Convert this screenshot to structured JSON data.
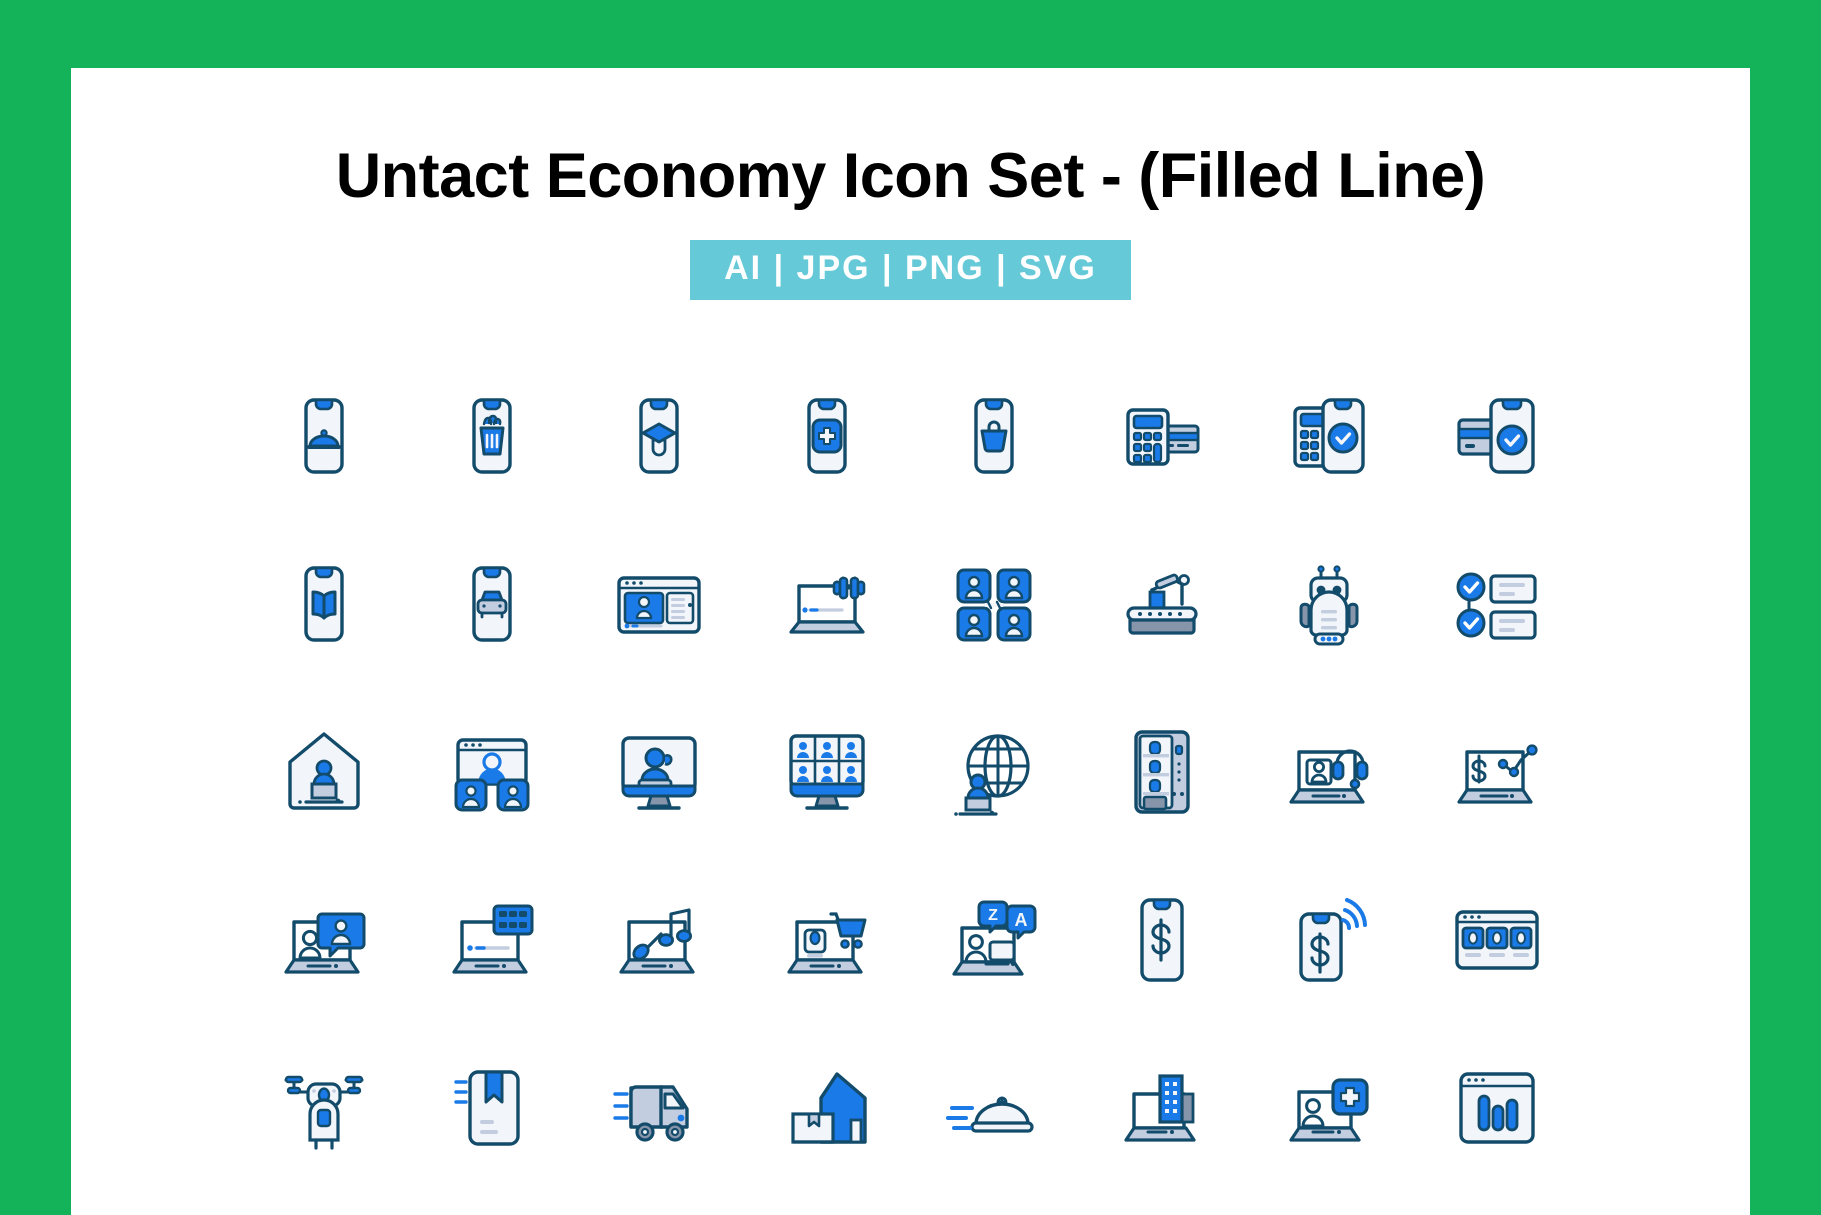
{
  "poster": {
    "frame_color": "#14b35a",
    "panel_color": "#ffffff",
    "title": "Untact Economy Icon Set - (Filled Line)",
    "badge": {
      "text": "AI | JPG | PNG | SVG",
      "background": "#66c9d8",
      "text_color": "#ffffff"
    }
  },
  "palette": {
    "outline": "#134b6b",
    "primary_blue": "#1a7ae8",
    "light_fill": "#f2f5fa",
    "grey_blue": "#c3cde0",
    "mid_grey": "#8795ab"
  },
  "grid": {
    "columns": 8,
    "rows": 5,
    "total_icons": 40
  },
  "icons": [
    {
      "id": "mobile-food-delivery",
      "label": "Mobile Food Delivery",
      "row": 1,
      "col": 1
    },
    {
      "id": "mobile-fast-food-order",
      "label": "Mobile Fast Food Order",
      "row": 1,
      "col": 2
    },
    {
      "id": "mobile-online-education",
      "label": "Mobile Online Education",
      "row": 1,
      "col": 3
    },
    {
      "id": "mobile-healthcare-app",
      "label": "Mobile Healthcare App",
      "row": 1,
      "col": 4
    },
    {
      "id": "mobile-shopping-basket",
      "label": "Mobile Shopping Basket",
      "row": 1,
      "col": 5
    },
    {
      "id": "card-reader-payment",
      "label": "Card Reader Payment",
      "row": 1,
      "col": 6
    },
    {
      "id": "pos-mobile-payment-approved",
      "label": "POS Mobile Payment Approved",
      "row": 1,
      "col": 7
    },
    {
      "id": "credit-card-mobile-verified",
      "label": "Credit Card Mobile Verified",
      "row": 1,
      "col": 8
    },
    {
      "id": "mobile-ebook-reading",
      "label": "Mobile E-Book Reading",
      "row": 2,
      "col": 1
    },
    {
      "id": "mobile-ride-hailing",
      "label": "Mobile Ride Hailing",
      "row": 2,
      "col": 2
    },
    {
      "id": "video-streaming-window",
      "label": "Video Streaming Window",
      "row": 2,
      "col": 3
    },
    {
      "id": "laptop-online-fitness",
      "label": "Laptop Online Fitness",
      "row": 2,
      "col": 4
    },
    {
      "id": "group-video-conference",
      "label": "Group Video Conference",
      "row": 2,
      "col": 5
    },
    {
      "id": "factory-automation-arm",
      "label": "Factory Automation Robot Arm",
      "row": 2,
      "col": 6
    },
    {
      "id": "service-robot",
      "label": "Service Robot",
      "row": 2,
      "col": 7
    },
    {
      "id": "online-checklist-approval",
      "label": "Online Checklist Approval",
      "row": 2,
      "col": 8
    },
    {
      "id": "work-from-home",
      "label": "Work From Home",
      "row": 3,
      "col": 1
    },
    {
      "id": "online-meeting-window",
      "label": "Online Meeting Window",
      "row": 3,
      "col": 2
    },
    {
      "id": "online-webinar-monitor",
      "label": "Online Webinar Monitor",
      "row": 3,
      "col": 3
    },
    {
      "id": "virtual-classroom-grid",
      "label": "Virtual Classroom Grid",
      "row": 3,
      "col": 4
    },
    {
      "id": "global-remote-work",
      "label": "Global Remote Work",
      "row": 3,
      "col": 5
    },
    {
      "id": "vending-machine",
      "label": "Vending Machine",
      "row": 3,
      "col": 6
    },
    {
      "id": "online-customer-support",
      "label": "Online Customer Support",
      "row": 3,
      "col": 7
    },
    {
      "id": "online-finance-analytics",
      "label": "Online Finance Analytics",
      "row": 3,
      "col": 8
    },
    {
      "id": "laptop-video-chat",
      "label": "Laptop Video Chat",
      "row": 4,
      "col": 1
    },
    {
      "id": "laptop-movie-streaming",
      "label": "Laptop Movie Streaming",
      "row": 4,
      "col": 2
    },
    {
      "id": "laptop-music-streaming",
      "label": "Laptop Music Streaming",
      "row": 4,
      "col": 3
    },
    {
      "id": "laptop-online-shopping",
      "label": "Laptop Online Shopping",
      "row": 4,
      "col": 4
    },
    {
      "id": "laptop-online-translation",
      "label": "Laptop Online Translation",
      "row": 4,
      "col": 5
    },
    {
      "id": "mobile-wallet",
      "label": "Mobile Wallet",
      "row": 4,
      "col": 6
    },
    {
      "id": "contactless-mobile-payment",
      "label": "Contactless Mobile Payment",
      "row": 4,
      "col": 7
    },
    {
      "id": "online-store-catalog",
      "label": "Online Store Catalog",
      "row": 4,
      "col": 8
    },
    {
      "id": "delivery-drone-robot",
      "label": "Delivery Drone Robot",
      "row": 5,
      "col": 1
    },
    {
      "id": "bookmarked-parcel",
      "label": "Bookmarked Parcel",
      "row": 5,
      "col": 2
    },
    {
      "id": "delivery-van",
      "label": "Delivery Van",
      "row": 5,
      "col": 3
    },
    {
      "id": "home-parcel-delivery",
      "label": "Home Parcel Delivery",
      "row": 5,
      "col": 4
    },
    {
      "id": "express-food-delivery",
      "label": "Express Food Delivery",
      "row": 5,
      "col": 5
    },
    {
      "id": "remote-office-laptop",
      "label": "Remote Office Laptop",
      "row": 5,
      "col": 6
    },
    {
      "id": "telemedicine-laptop",
      "label": "Telemedicine Laptop",
      "row": 5,
      "col": 7
    },
    {
      "id": "online-analytics-dashboard",
      "label": "Online Analytics Dashboard",
      "row": 5,
      "col": 8
    }
  ]
}
